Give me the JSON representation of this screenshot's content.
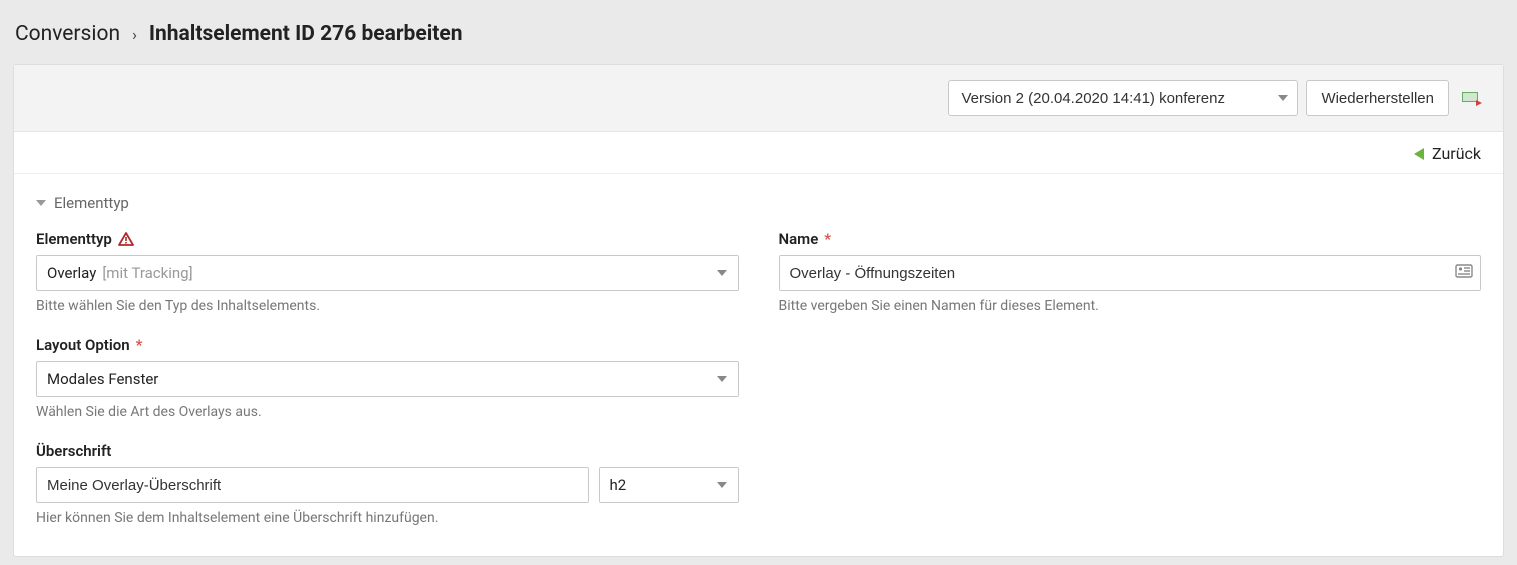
{
  "breadcrumb": {
    "root": "Conversion",
    "separator": "›",
    "current": "Inhaltselement ID 276 bearbeiten"
  },
  "toolbar": {
    "version_selected": "Version 2 (20.04.2020 14:41) konferenz",
    "restore_label": "Wiederherstellen"
  },
  "back": {
    "label": "Zurück"
  },
  "section": {
    "title": "Elementtyp"
  },
  "fields": {
    "elementtyp": {
      "label": "Elementtyp",
      "value": "Overlay",
      "suffix": "[mit Tracking]",
      "help": "Bitte wählen Sie den Typ des Inhaltselements."
    },
    "name": {
      "label": "Name",
      "value": "Overlay - Öffnungszeiten",
      "help": "Bitte vergeben Sie einen Namen für dieses Element."
    },
    "layout": {
      "label": "Layout Option",
      "value": "Modales Fenster",
      "help": "Wählen Sie die Art des Overlays aus."
    },
    "headline": {
      "label": "Überschrift",
      "value": "Meine Overlay-Überschrift",
      "level": "h2",
      "help": "Hier können Sie dem Inhaltselement eine Überschrift hinzufügen."
    }
  }
}
